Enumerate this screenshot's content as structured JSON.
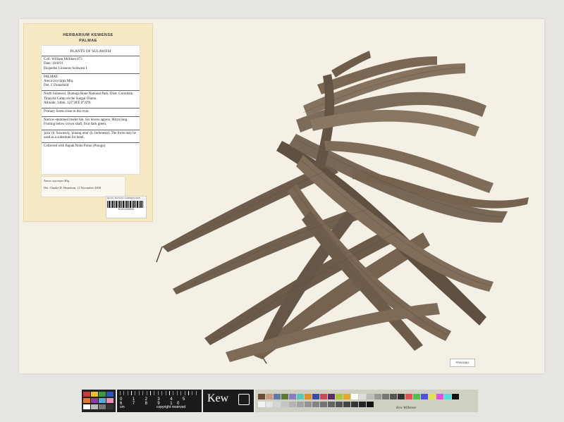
{
  "herbarium": {
    "line1": "HERBARIUM KEWENSE",
    "line2": "PALMAE"
  },
  "label": {
    "title": "PLANTS OF SULAWESI",
    "coll": "Coll: William Milliken 873",
    "date": "Date: 10/8/91",
    "expedition": "Ekspedisi Linnaeus Sulawesi I",
    "family": "PALMAE",
    "taxon": "Areca oxycarpa Miq.",
    "det": "Det. J. Dransfield",
    "locality": "North Sulawesi, Dumoga Bone National Park. Distr. Gorontalo. Tinayola Camp on the Sungai Olamu.",
    "altitude": "Altitude: 340m. 123°28'E 0°32'N",
    "habitat": "Primary forest close to the river.",
    "description": "Narrow-stemmed treelet 6m. Six leaves approx. 80cm long. Fruiting below crown shaft, fruit dark green.",
    "vernacular": "'pisa' (b. Suwawa), 'pinang utan' (b. Indonesia). The fruits may be used as a substitute for betel.",
    "collected_with": "Collected with Bapak Noho Poluo (Pinogu)"
  },
  "determination": {
    "taxon": "Areca oxycarpa Miq.",
    "det": "Det. Charlie D. Heatubun, 11 November 2008"
  },
  "stickers": {
    "line1": "ROYAL BOTANIC GARDENS KEW",
    "barcode_number": "K001105544"
  },
  "reference_label": "PR001662",
  "scale_bar": {
    "numbers": "0 1 2 3 4 5 6 7 8 9 10",
    "unit": "cm",
    "copyright": "copyright reserved",
    "brand": "Kew",
    "card_brand": "Kew Willemse"
  },
  "colors": {
    "sheet": "#f4f0e6",
    "leaf_dark": "#6a5a4a",
    "leaf_mid": "#85725f",
    "tag": "#f6e9c4"
  }
}
